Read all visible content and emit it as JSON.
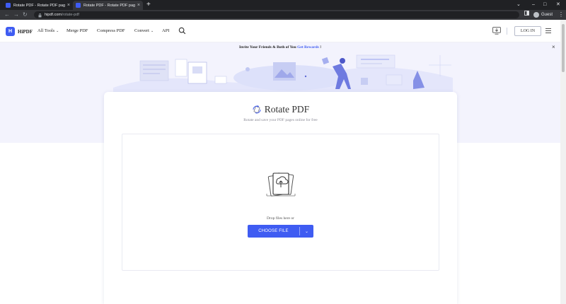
{
  "browser": {
    "tabs": [
      {
        "title": "Rotate PDF - Rotate PDF pages o",
        "close": "×"
      },
      {
        "title": "Rotate PDF - Rotate PDF pages o",
        "close": "×"
      }
    ],
    "new_tab": "+",
    "window_controls": {
      "minimize": "–",
      "maximize": "□",
      "close": "✕",
      "tab_search": "⌄"
    },
    "nav": {
      "back": "←",
      "forward": "→",
      "reload": "↻"
    },
    "url_host": "hipdf.com",
    "url_path": "/rotate-pdf",
    "profile": "Guest",
    "menu": "⋮"
  },
  "header": {
    "logo_mark": "H",
    "logo_text": "HiPDF",
    "nav": [
      {
        "label": "All Tools",
        "dropdown": true
      },
      {
        "label": "Merge PDF",
        "dropdown": false
      },
      {
        "label": "Compress PDF",
        "dropdown": false
      },
      {
        "label": "Convert",
        "dropdown": true
      },
      {
        "label": "API",
        "dropdown": false
      }
    ],
    "caret": "⌄",
    "login": "LOG IN"
  },
  "banner": {
    "invite_text": "Invite Your Friends & Both of You ",
    "invite_link": "Get Rewards",
    "invite_tail": " !",
    "close": "×"
  },
  "main": {
    "title": "Rotate PDF",
    "subtitle": "Rotate and save your PDF pages online for free",
    "drop_text": "Drop files here or",
    "choose_button": "CHOOSE FILE",
    "choose_arrow": "⌄"
  },
  "colors": {
    "brand": "#3f5cf2",
    "hero_bg": "#f3f3fd",
    "chrome_dark": "#202124"
  }
}
